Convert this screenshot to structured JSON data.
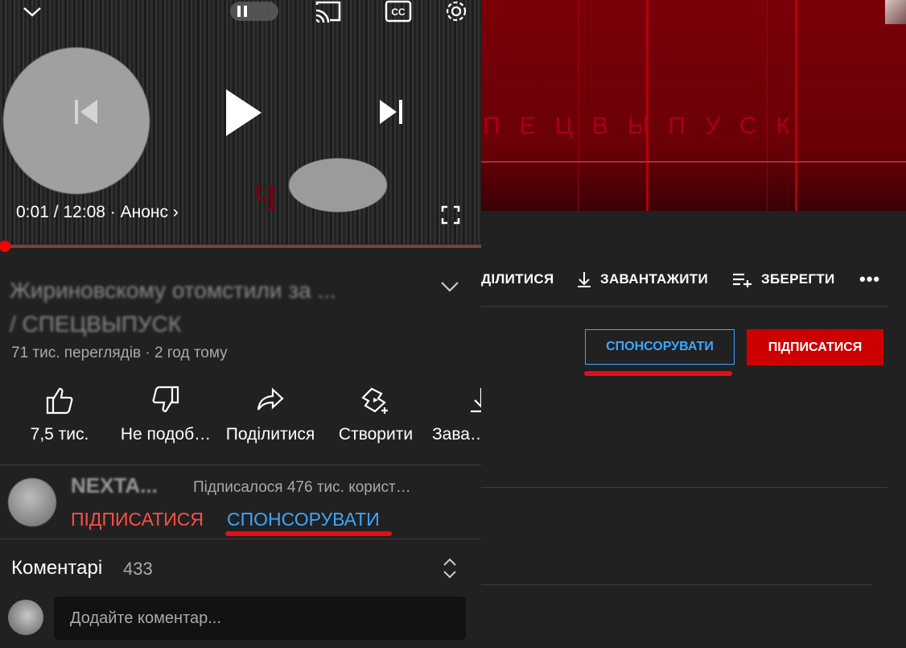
{
  "desktop": {
    "banner_text": "ПЕЦВЫПУСК",
    "actions": {
      "share": "ДІЛИТИСЯ",
      "download": "ЗАВАНТАЖИТИ",
      "save": "ЗБЕРЕГТИ",
      "more": "•••"
    },
    "sponsor_label": "СПОНСОРУВАТИ",
    "subscribe_label": "ПІДПИСАТИСЯ"
  },
  "player": {
    "time": "0:01 / 12:08 · Анонс ›",
    "progress": 0.001,
    "overlay_letter": "Ч"
  },
  "video": {
    "title": "Жириновскому отомстили за ... / СПЕЦВЫПУСК",
    "views": "71 тис. переглядів · 2 год тому"
  },
  "mobile_actions": {
    "like": "7,5 тис.",
    "dislike": "Не подоб…",
    "share": "Поділитися",
    "create": "Створити",
    "download": "Зава…"
  },
  "channel": {
    "name": "NEXTA...",
    "subscribers": "Підписалося 476 тис. корист…",
    "subscribe_label": "ПІДПИСАТИСЯ",
    "sponsor_label": "СПОНСОРУВАТИ"
  },
  "comments": {
    "title": "Коментарі",
    "count": "433",
    "placeholder": "Додайте коментар..."
  },
  "colors": {
    "accent_red": "#cc0000",
    "link_blue": "#3ea6ff",
    "subscribe_red": "#ff4e45",
    "background": "#212121"
  }
}
